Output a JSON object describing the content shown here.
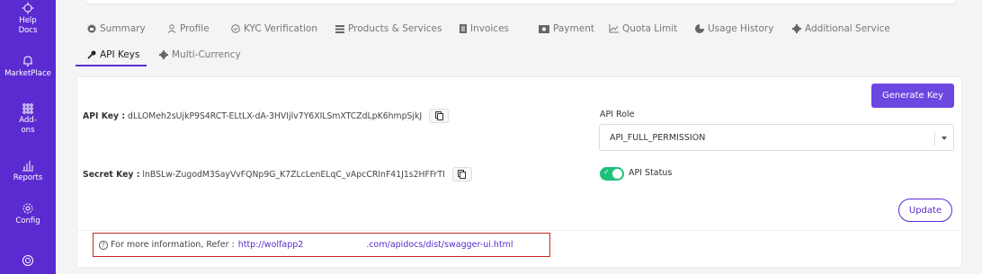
{
  "sidebar": {
    "items": [
      {
        "label": "Help Docs",
        "icon": "help-docs-icon"
      },
      {
        "label": "MarketPlace",
        "icon": "marketplace-icon"
      },
      {
        "label": "Add-ons",
        "icon": "addons-icon"
      },
      {
        "label": "Reports",
        "icon": "reports-icon"
      },
      {
        "label": "Config",
        "icon": "config-icon"
      },
      {
        "label": "",
        "icon": "support-icon"
      }
    ],
    "help_line1": "Help",
    "help_line2": "Docs",
    "addons_line1": "Add-",
    "addons_line2": "ons",
    "color": "#5b2bd1"
  },
  "tabs": {
    "row1": [
      "Summary",
      "Profile",
      "KYC Verification",
      "Products & Services",
      "Invoices",
      "Payment",
      "Quota Limit",
      "Usage History",
      "Additional Service"
    ],
    "row2": [
      "API Keys",
      "Multi-Currency"
    ],
    "active": "API Keys"
  },
  "api": {
    "api_key_label": "API Key :",
    "api_key_value": "dLLOMeh2sUjkP9S4RCT-ELtLX-dA-3HVIjlv7Y6XILSmXTCZdLpK6hmpSjkJ",
    "secret_key_label": "Secret Key :",
    "secret_key_value": "lnBSLw-ZugodM3SayVvFQNp9G_K7ZLcLenELqC_vApcCRInF41J1s2HFFrTI",
    "generate_label": "Generate Key",
    "role_label": "API Role",
    "role_value": "API_FULL_PERMISSION",
    "status_label": "API Status",
    "status_on": true,
    "update_label": "Update"
  },
  "info": {
    "text": "For more information, Refer :",
    "link_part1": "http://wolfapp2",
    "link_part2": ".com/apidocs/dist/swagger-ui.html"
  },
  "colors": {
    "accent": "#5b2bd1",
    "button": "#6c47e0",
    "toggle": "#1ec17a",
    "highlight_border": "#c62828"
  }
}
